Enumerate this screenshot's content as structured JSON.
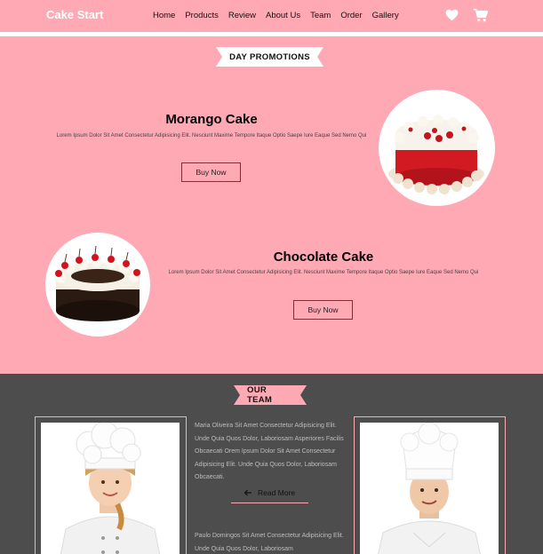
{
  "header": {
    "brand": "Cake Start",
    "nav": [
      "Home",
      "Products",
      "Review",
      "About Us",
      "Team",
      "Order",
      "Gallery"
    ],
    "icons": [
      "heart-icon",
      "cart-icon"
    ]
  },
  "promotions": {
    "section_title": "DAY PROMOTIONS",
    "items": [
      {
        "title": "Morango Cake",
        "description": "Lorem Ipsum Dolor Sit Amet Consectetur Adipisicing Elit. Nesciunt Maxime Tempore Itaque Optio Saepe Iure Eaque Sed Nemo Qui",
        "button": "Buy Now"
      },
      {
        "title": "Chocolate Cake",
        "description": "Lorem Ipsum Dolor Sit Amet Consectetur Adipisicing Elit. Nesciunt Maxime Tempore Itaque Optio Saepe Iure Eaque Sed Nemo Qui",
        "button": "Buy Now"
      }
    ]
  },
  "team": {
    "section_title": "OUR TEAM",
    "members": [
      {
        "text": "Maria Oliveira Sit Amet Consectetur Adipisicing Elit. Unde Quia Quos Dolor, Laboriosam Asperiores Facilis Obcaecati Orem Ipsum Dolor Sit Amet Consectetur Adipisicing Elit. Unde Quia Quos Dolor, Laboriosam Obcaecati.",
        "read_more": "Read More"
      },
      {
        "text": "Paulo Domingos Sit Amet Consectetur Adipisicing Elit. Unde Quia Quos Dolor, Laboriosam"
      }
    ]
  },
  "colors": {
    "brand_pink": "#ffa9b5",
    "team_bg": "#4d4d4d",
    "button_border": "#8a2a35"
  }
}
